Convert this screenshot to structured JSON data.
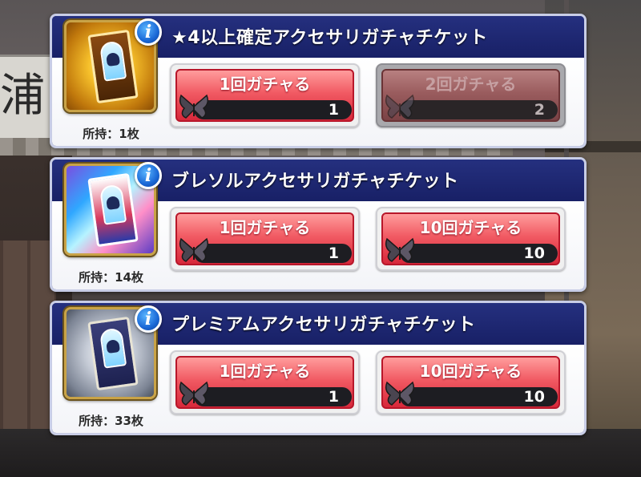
{
  "background": {
    "sign_char": "浦"
  },
  "icons": {
    "info": "info-icon",
    "currency": "butterfly-icon",
    "ticket": "ticket-icon"
  },
  "colors": {
    "header_navy": "#1b2470",
    "button_red": "#e84352",
    "button_disabled": "#9a5c5e",
    "info_blue": "#1a68d6"
  },
  "panels": [
    {
      "title": "★4以上確定アクセサリガチャチケット",
      "info_label": "i",
      "owned": "所持：1枚",
      "ticket_style": "gold",
      "buttons": [
        {
          "label": "1回ガチャる",
          "cost": "1",
          "enabled": true
        },
        {
          "label": "2回ガチャる",
          "cost": "2",
          "enabled": false
        }
      ]
    },
    {
      "title": "ブレソルアクセサリガチャチケット",
      "info_label": "i",
      "owned": "所持：14枚",
      "ticket_style": "rainbow",
      "buttons": [
        {
          "label": "1回ガチャる",
          "cost": "1",
          "enabled": true
        },
        {
          "label": "10回ガチャる",
          "cost": "10",
          "enabled": true
        }
      ]
    },
    {
      "title": "プレミアムアクセサリガチャチケット",
      "info_label": "i",
      "owned": "所持：33枚",
      "ticket_style": "silver",
      "buttons": [
        {
          "label": "1回ガチャる",
          "cost": "1",
          "enabled": true
        },
        {
          "label": "10回ガチャる",
          "cost": "10",
          "enabled": true
        }
      ]
    }
  ]
}
